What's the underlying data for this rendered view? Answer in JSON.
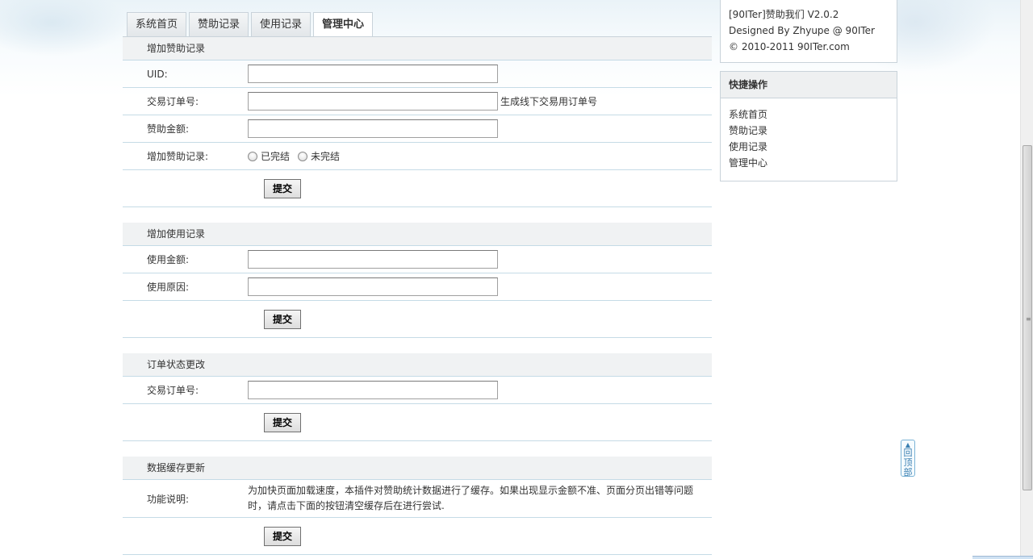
{
  "tabs": [
    {
      "label": "系统首页",
      "active": false
    },
    {
      "label": "赞助记录",
      "active": false
    },
    {
      "label": "使用记录",
      "active": false
    },
    {
      "label": "管理中心",
      "active": true
    }
  ],
  "add_sponsor": {
    "title": "增加赞助记录",
    "uid_label": "UID:",
    "uid_value": "",
    "order_label": "交易订单号:",
    "order_value": "",
    "order_hint": "生成线下交易用订单号",
    "amount_label": "赞助金额:",
    "amount_value": "",
    "status_label": "增加赞助记录:",
    "status_options": [
      "已完结",
      "未完结"
    ],
    "submit_label": "提交"
  },
  "add_usage": {
    "title": "增加使用记录",
    "amount_label": "使用金额:",
    "amount_value": "",
    "reason_label": "使用原因:",
    "reason_value": "",
    "submit_label": "提交"
  },
  "order_status": {
    "title": "订单状态更改",
    "order_label": "交易订单号:",
    "order_value": "",
    "submit_label": "提交"
  },
  "cache_update": {
    "title": "数据缓存更新",
    "desc_label": "功能说明:",
    "desc_text": "为加快页面加载速度，本插件对赞助统计数据进行了缓存。如果出现显示金额不准、页面分页出错等问题时，请点击下面的按钮清空缓存后在进行尝试.",
    "submit_label": "提交"
  },
  "info": {
    "line1": "[90ITer]赞助我们 V2.0.2",
    "line2": "Designed By Zhyupe @ 90ITer",
    "line3": "© 2010-2011 90ITer.com"
  },
  "quick": {
    "title": "快捷操作",
    "items": [
      "系统首页",
      "赞助记录",
      "使用记录",
      "管理中心"
    ]
  },
  "back_top": {
    "label": "回顶部"
  }
}
